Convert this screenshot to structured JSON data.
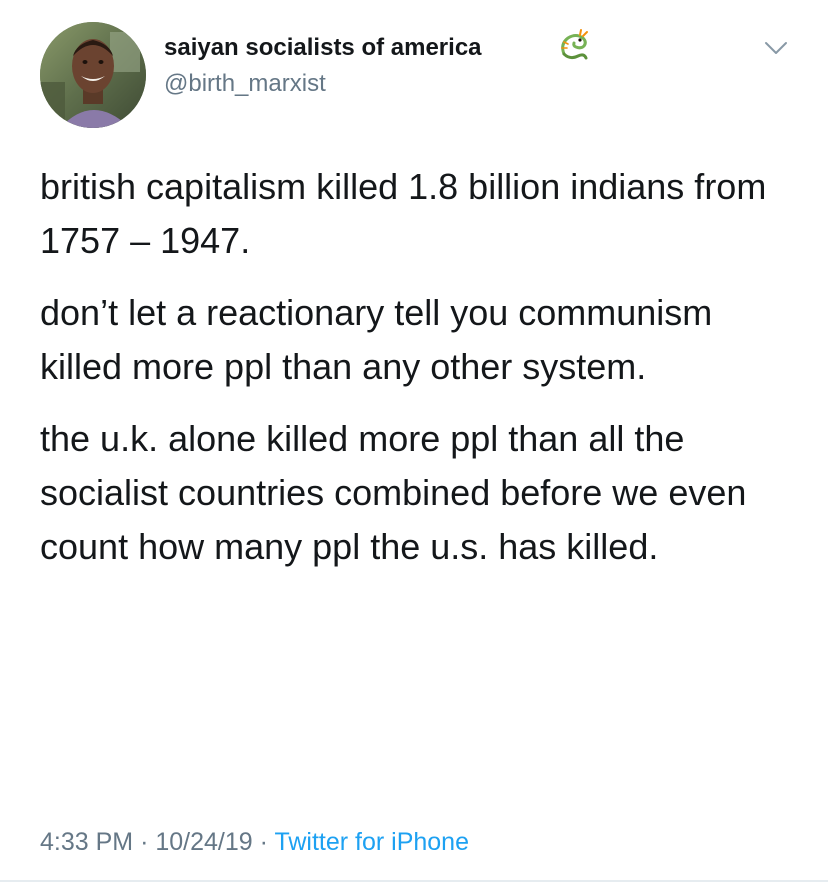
{
  "tweet": {
    "display_name": "saiyan socialists of america",
    "name_emoji_icon": "dragon-emoji-icon",
    "handle": "@birth_marxist",
    "paragraphs": [
      "british capitalism killed 1.8 billion indians from 1757 – 1947.",
      "don’t let a reactionary tell you communism killed more ppl than any other system.",
      "the u.k. alone killed more ppl than all the socialist countries combined before we even count how many ppl the u.s. has killed."
    ],
    "time": "4:33 PM",
    "date": "10/24/19",
    "separator": "·",
    "source": "Twitter for iPhone"
  },
  "colors": {
    "text": "#14171a",
    "secondary": "#657786",
    "link": "#1da1f2",
    "divider": "#e6ecf0"
  }
}
